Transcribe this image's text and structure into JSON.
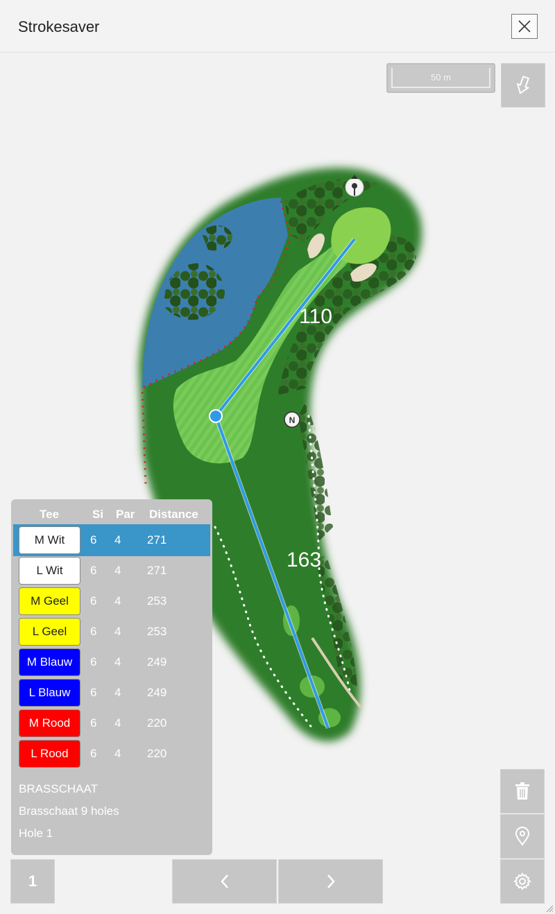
{
  "header": {
    "title": "Strokesaver",
    "close_icon": "close-icon"
  },
  "scale": {
    "label": "50 m"
  },
  "map": {
    "distances": [
      {
        "value": "110"
      },
      {
        "value": "163"
      }
    ],
    "compass_label": "N",
    "line_color": "#2f9be8",
    "water_color": "#3c7fae",
    "fairway_color": "#2f8a2e"
  },
  "tee_table": {
    "headers": {
      "tee": "Tee",
      "si": "Si",
      "par": "Par",
      "distance": "Distance"
    },
    "rows": [
      {
        "tee": "M Wit",
        "si": "6",
        "par": "4",
        "distance": "271",
        "bg": "#ffffff",
        "fg": "#222222",
        "selected": true
      },
      {
        "tee": "L Wit",
        "si": "6",
        "par": "4",
        "distance": "271",
        "bg": "#ffffff",
        "fg": "#222222",
        "selected": false
      },
      {
        "tee": "M Geel",
        "si": "6",
        "par": "4",
        "distance": "253",
        "bg": "#ffff00",
        "fg": "#222222",
        "selected": false
      },
      {
        "tee": "L Geel",
        "si": "6",
        "par": "4",
        "distance": "253",
        "bg": "#ffff00",
        "fg": "#222222",
        "selected": false
      },
      {
        "tee": "M Blauw",
        "si": "6",
        "par": "4",
        "distance": "249",
        "bg": "#0000ff",
        "fg": "#ffffff",
        "selected": false
      },
      {
        "tee": "L Blauw",
        "si": "6",
        "par": "4",
        "distance": "249",
        "bg": "#0000ff",
        "fg": "#ffffff",
        "selected": false
      },
      {
        "tee": "M Rood",
        "si": "6",
        "par": "4",
        "distance": "220",
        "bg": "#ff0000",
        "fg": "#ffffff",
        "selected": false
      },
      {
        "tee": "L Rood",
        "si": "6",
        "par": "4",
        "distance": "220",
        "bg": "#ff0000",
        "fg": "#ffffff",
        "selected": false
      }
    ]
  },
  "course_info": {
    "club": "BRASSCHAAT",
    "course": "Brasschaat 9 holes",
    "hole": "Hole 1"
  },
  "bottom": {
    "hole_number": "1",
    "prev_icon": "chevron-left-icon",
    "next_icon": "chevron-right-icon"
  },
  "tools": {
    "cursor_icon": "pointer-hand-icon",
    "trash_icon": "trash-icon",
    "pin_icon": "location-pin-icon",
    "settings_icon": "gear-icon"
  }
}
